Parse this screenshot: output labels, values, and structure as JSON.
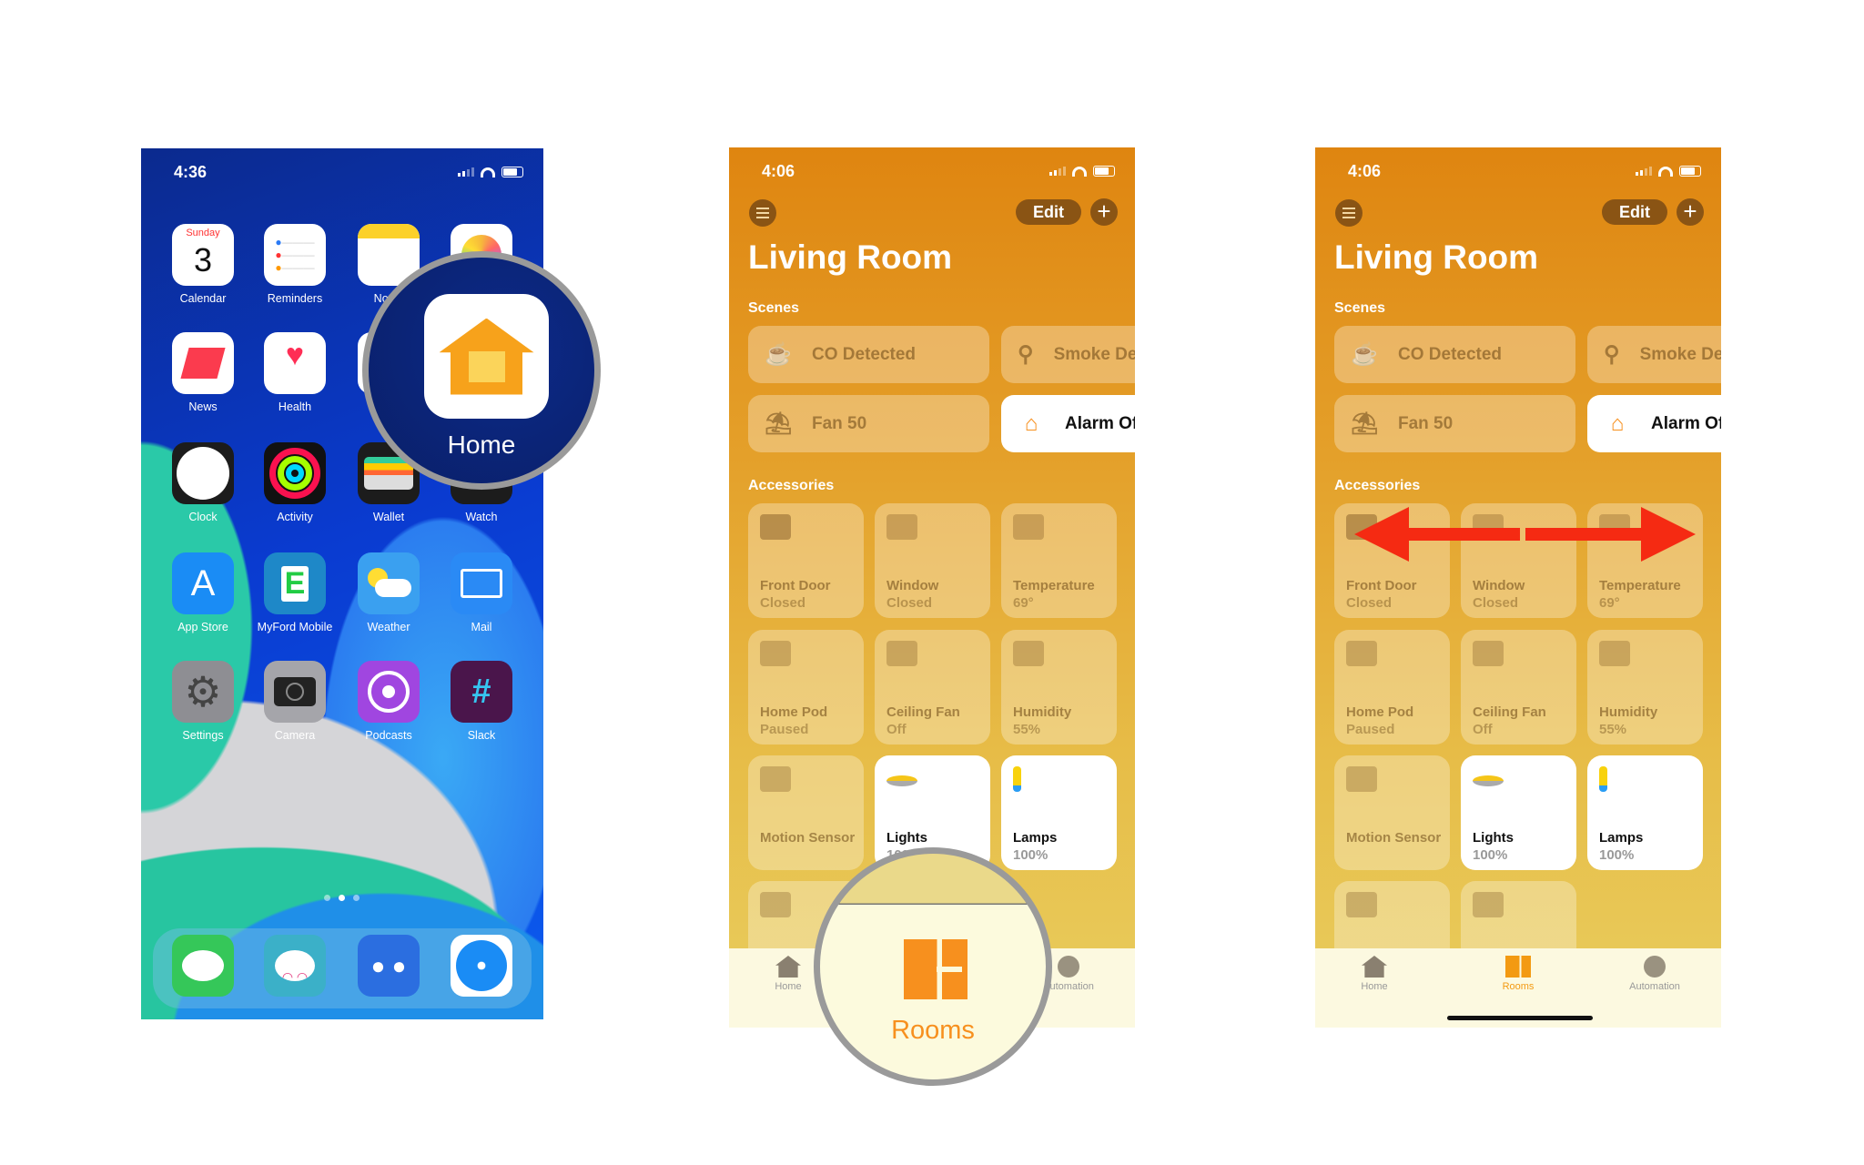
{
  "home_screen": {
    "time": "4:36",
    "apps": [
      {
        "label": "Calendar",
        "icon": "calendar-icon",
        "color": "#ffffff",
        "day": "Sunday",
        "date": "3"
      },
      {
        "label": "Reminders",
        "icon": "reminders-icon",
        "color": "#ffffff"
      },
      {
        "label": "Notes",
        "icon": "notes-icon",
        "color": "#ffffff"
      },
      {
        "label": "Photos",
        "icon": "photos-icon",
        "color": "#ffffff"
      },
      {
        "label": "News",
        "icon": "news-icon",
        "color": "#ffffff"
      },
      {
        "label": "Health",
        "icon": "health-icon",
        "color": "#ffffff"
      },
      {
        "label": "",
        "icon": "app-icon",
        "color": "#ffffff"
      },
      {
        "label": "",
        "icon": "app-icon",
        "color": "#ffffff"
      },
      {
        "label": "Clock",
        "icon": "clock-icon",
        "color": "#1c1c1c"
      },
      {
        "label": "Activity",
        "icon": "activity-icon",
        "color": "#111111"
      },
      {
        "label": "Wallet",
        "icon": "wallet-icon",
        "color": "#1c1c1c"
      },
      {
        "label": "Watch",
        "icon": "watch-icon",
        "color": "#1c1c1c"
      },
      {
        "label": "App Store",
        "icon": "app-store-icon",
        "color": "#1a8cf5"
      },
      {
        "label": "MyFord Mobile",
        "icon": "myford-icon",
        "color": "#1e88c8"
      },
      {
        "label": "Weather",
        "icon": "weather-icon",
        "color": "#3aa0f0"
      },
      {
        "label": "Mail",
        "icon": "mail-icon",
        "color": "#2a8af5"
      },
      {
        "label": "Settings",
        "icon": "settings-icon",
        "color": "#8e8e93"
      },
      {
        "label": "Camera",
        "icon": "camera-icon",
        "color": "#a5a5aa"
      },
      {
        "label": "Podcasts",
        "icon": "podcasts-icon",
        "color": "#a046e0"
      },
      {
        "label": "Slack",
        "icon": "slack-icon",
        "color": "#4a154b"
      }
    ],
    "dock": [
      {
        "icon": "messages-icon",
        "color": "#35c759"
      },
      {
        "icon": "robot-app-icon",
        "color": "#3bb0c8"
      },
      {
        "icon": "tweetbot-icon",
        "color": "#2b6ee0"
      },
      {
        "icon": "safari-icon",
        "color": "#ffffff"
      }
    ],
    "magnifier_label": "Home",
    "accent": "#f7a21b"
  },
  "home_app_before": {
    "time": "4:06",
    "edit_label": "Edit",
    "add_label": "+",
    "title": "Living Room",
    "scenes_label": "Scenes",
    "scenes": [
      {
        "label": "CO Detected",
        "icon": "coffee-icon",
        "active": false
      },
      {
        "label": "Smoke Detected",
        "icon": "smoke-detector-icon",
        "active": false
      },
      {
        "label": "Fan 50",
        "icon": "lounge-chair-icon",
        "active": false
      },
      {
        "label": "Alarm Off",
        "icon": "house-icon",
        "active": true
      }
    ],
    "accessories_label": "Accessories",
    "accessories": [
      {
        "name": "Front Door",
        "status": "Closed",
        "icon": "door-icon",
        "active": false
      },
      {
        "name": "Window",
        "status": "Closed",
        "icon": "window-icon",
        "active": false
      },
      {
        "name": "Temperature",
        "status": "69°",
        "icon": "thermometer-icon",
        "active": false
      },
      {
        "name": "Home Pod",
        "status": "Paused",
        "icon": "homepod-icon",
        "active": false
      },
      {
        "name": "Ceiling Fan",
        "status": "Off",
        "icon": "ceiling-fan-icon",
        "active": false
      },
      {
        "name": "Humidity",
        "status": "55%",
        "icon": "humidity-icon",
        "active": false
      },
      {
        "name": "Motion Sensor",
        "status": "",
        "icon": "motion-sensor-icon",
        "active": false
      },
      {
        "name": "Lights",
        "status": "100%",
        "icon": "light-icon",
        "active": true
      },
      {
        "name": "Lamps",
        "status": "100%",
        "icon": "lamp-icon",
        "active": true
      },
      {
        "name": "",
        "status": "",
        "icon": "lock-icon",
        "active": false
      }
    ],
    "tabs": [
      {
        "label": "Home",
        "icon": "home-tab-icon"
      },
      {
        "label": "Rooms",
        "icon": "rooms-tab-icon",
        "active": true
      },
      {
        "label": "Automation",
        "icon": "automation-tab-icon"
      }
    ],
    "magnifier_label": "Rooms"
  },
  "home_app_after": {
    "time": "4:06",
    "edit_label": "Edit",
    "add_label": "+",
    "title": "Living Room",
    "scenes_label": "Scenes",
    "scenes": [
      {
        "label": "CO Detected",
        "icon": "coffee-icon",
        "active": false
      },
      {
        "label": "Smoke Detected",
        "icon": "smoke-detector-icon",
        "active": false
      },
      {
        "label": "Fan 50",
        "icon": "lounge-chair-icon",
        "active": false
      },
      {
        "label": "Alarm Off",
        "icon": "house-icon",
        "active": true
      }
    ],
    "accessories_label": "Accessories",
    "accessories": [
      {
        "name": "Front Door",
        "status": "Closed",
        "icon": "door-icon",
        "active": false
      },
      {
        "name": "Window",
        "status": "Closed",
        "icon": "window-icon",
        "active": false
      },
      {
        "name": "Temperature",
        "status": "69°",
        "icon": "thermometer-icon",
        "active": false
      },
      {
        "name": "Home Pod",
        "status": "Paused",
        "icon": "homepod-icon",
        "active": false
      },
      {
        "name": "Ceiling Fan",
        "status": "Off",
        "icon": "ceiling-fan-icon",
        "active": false
      },
      {
        "name": "Humidity",
        "status": "55%",
        "icon": "humidity-icon",
        "active": false
      },
      {
        "name": "Motion Sensor",
        "status": "",
        "icon": "motion-sensor-icon",
        "active": false
      },
      {
        "name": "Lights",
        "status": "100%",
        "icon": "light-icon",
        "active": true
      },
      {
        "name": "Lamps",
        "status": "100%",
        "icon": "lamp-icon",
        "active": true
      },
      {
        "name": "",
        "status": "",
        "icon": "lock-icon",
        "active": false
      },
      {
        "name": "",
        "status": "",
        "icon": "apple-tv-icon",
        "active": false
      }
    ],
    "tabs": [
      {
        "label": "Home",
        "icon": "home-tab-icon"
      },
      {
        "label": "Rooms",
        "icon": "rooms-tab-icon",
        "active": true
      },
      {
        "label": "Automation",
        "icon": "automation-tab-icon"
      }
    ],
    "annotation_color": "#f52a12"
  }
}
